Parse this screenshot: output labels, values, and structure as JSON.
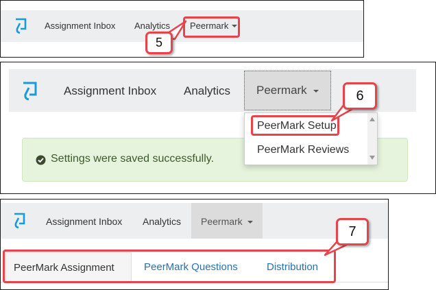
{
  "colors": {
    "navbar_bg": "#eceeef",
    "active_tab_bg": "#dcdcdc",
    "callout_red": "#e8424b",
    "link_blue": "#2a6fb0",
    "success_bg": "#e6f4dd",
    "success_text": "#3c5a2a",
    "logo_blue": "#1a9ad6"
  },
  "icons": {
    "logo": "turnitin-logo-icon",
    "success": "check-circle-icon",
    "caret": "caret-down-icon",
    "scroll_up": "scroll-up-arrow-icon",
    "scroll_down": "scroll-down-arrow-icon"
  },
  "step5": {
    "nav": {
      "assignment_inbox": "Assignment Inbox",
      "analytics": "Analytics",
      "peermark": "Peermark"
    },
    "callout": "5"
  },
  "step6": {
    "nav": {
      "assignment_inbox": "Assignment Inbox",
      "analytics": "Analytics",
      "peermark": "Peermark"
    },
    "dropdown": [
      "PeerMark Setup",
      "PeerMark Reviews"
    ],
    "alert": "Settings were saved successfully.",
    "callout": "6"
  },
  "step7": {
    "nav": {
      "assignment_inbox": "Assignment Inbox",
      "analytics": "Analytics",
      "peermark": "Peermark"
    },
    "tabs": [
      "PeerMark Assignment",
      "PeerMark Questions",
      "Distribution"
    ],
    "active_tab": "PeerMark Assignment",
    "callout": "7"
  }
}
